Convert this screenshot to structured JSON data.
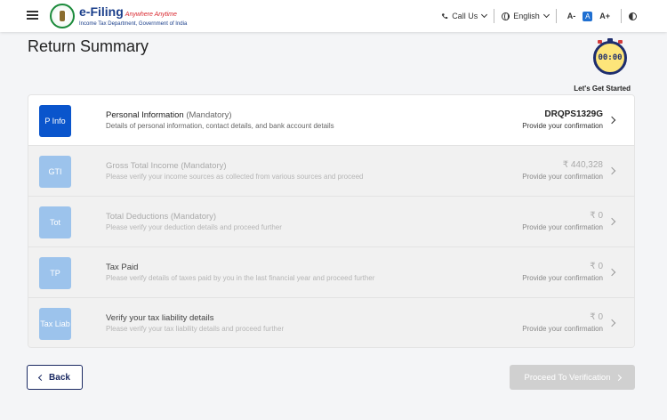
{
  "header": {
    "logo_main": "e-Filing",
    "logo_tagline": "Anywhere Anytime",
    "logo_sub": "Income Tax Department, Government of India",
    "call_us": "Call Us",
    "language": "English",
    "font_decrease": "A-",
    "font_normal": "A",
    "font_increase": "A+"
  },
  "page": {
    "title": "Return Summary",
    "timer": "00:00",
    "timer_label": "Let's Get Started"
  },
  "rows": [
    {
      "badge": "P Info",
      "title": "Personal Information",
      "mandatory": "(Mandatory)",
      "desc": "Details of personal information, contact details, and bank account details",
      "value": "DRQPS1329G",
      "confirm": "Provide your confirmation"
    },
    {
      "badge": "GTI",
      "title": "Gross Total Income",
      "mandatory": "(Mandatory)",
      "desc": "Please verify your income sources as collected from various sources and proceed",
      "value": "₹ 440,328",
      "confirm": "Provide your confirmation"
    },
    {
      "badge": "Tot",
      "title": "Total Deductions",
      "mandatory": "(Mandatory)",
      "desc": "Please verify your deduction details and proceed further",
      "value": "₹ 0",
      "confirm": "Provide your confirmation"
    },
    {
      "badge": "TP",
      "title": "Tax Paid",
      "mandatory": "",
      "desc": "Please verify details of taxes paid by you in the last financial year and proceed further",
      "value": "₹ 0",
      "confirm": "Provide your confirmation"
    },
    {
      "badge": "Tax Liab",
      "title": "Verify your tax liability details",
      "mandatory": "",
      "desc": "Please verify your tax liability details and proceed further",
      "value": "₹ 0",
      "confirm": "Provide your confirmation"
    }
  ],
  "footer": {
    "back": "Back",
    "proceed": "Proceed To Verification"
  },
  "colors": {
    "active_badge": "#0a55cc",
    "inactive_badge": "#9cc3ec",
    "primary_navy": "#1b2a63",
    "disabled_button": "#d0d0d0"
  }
}
